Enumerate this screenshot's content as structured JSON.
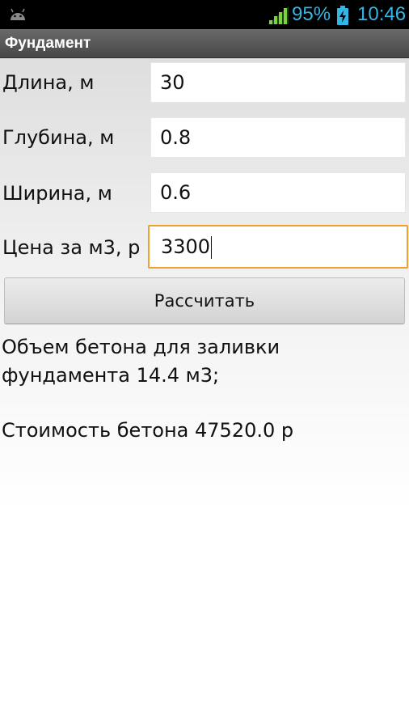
{
  "statusbar": {
    "battery_percent": "95%",
    "time": "10:46",
    "accent_color": "#33b5e5",
    "icons": [
      "android-icon",
      "signal-icon",
      "battery-charging-icon"
    ]
  },
  "app": {
    "title": "Фундамент"
  },
  "form": {
    "length_label": "Длина, м",
    "length_value": "30",
    "depth_label": "Глубина, м",
    "depth_value": "0.8",
    "width_label": "Ширина, м",
    "width_value": "0.6",
    "price_label": "Цена за м3, р",
    "price_value": "3300",
    "focus_color": "#f0a030"
  },
  "calculate_button": {
    "label": "Рассчитать"
  },
  "result": {
    "volume_line1": "Объем бетона для заливки",
    "volume_line2": "фундамента 14.4 м3;",
    "cost": "Стоимость бетона 47520.0 р"
  }
}
